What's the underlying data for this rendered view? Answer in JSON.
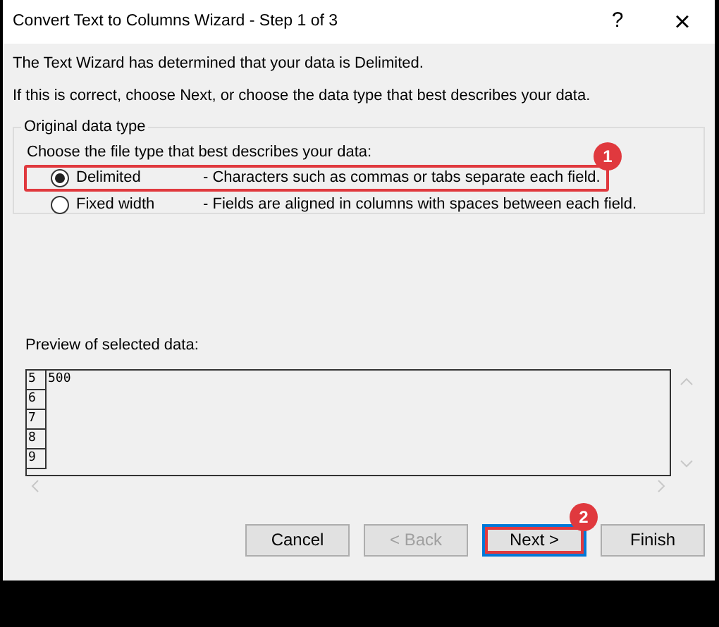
{
  "window": {
    "title": "Convert Text to Columns Wizard - Step 1 of 3",
    "help": "?",
    "close": "×"
  },
  "intro": [
    "The Text Wizard has determined that your data is Delimited.",
    "If this is correct, choose Next, or choose the data type that best describes your data."
  ],
  "group": {
    "title": "Original data type",
    "prompt": "Choose the file type that best describes your data:",
    "options": [
      {
        "label": "Delimited",
        "description": "- Characters such as commas or tabs separate each field.",
        "selected": true,
        "callout": "1"
      },
      {
        "label": "Fixed width",
        "description": "- Fields are aligned in columns with spaces between each field.",
        "selected": false
      }
    ]
  },
  "preview": {
    "label": "Preview of selected data:",
    "rows": [
      {
        "number": "5",
        "text": "500"
      },
      {
        "number": "6"
      },
      {
        "number": "7"
      },
      {
        "number": "8"
      },
      {
        "number": "9"
      }
    ]
  },
  "buttons": [
    {
      "label": "Cancel",
      "disabled": false
    },
    {
      "label": "< Back",
      "disabled": true
    },
    {
      "label": "Next >",
      "disabled": false,
      "default": true,
      "callout": "2"
    },
    {
      "label": "Finish",
      "disabled": false
    }
  ]
}
